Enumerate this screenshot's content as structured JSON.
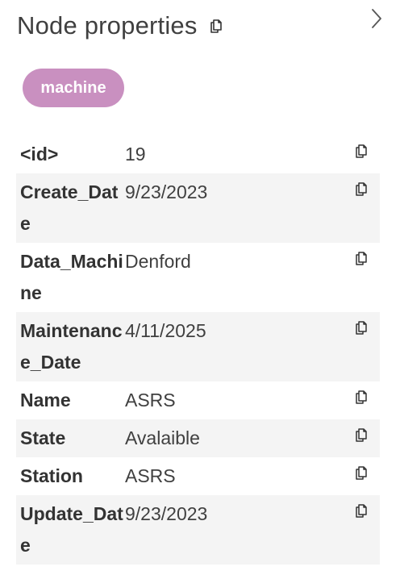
{
  "panel": {
    "title": "Node properties",
    "label_badge": "machine",
    "badge_color": "#c990c0",
    "icons": {
      "title_copy": "copy-icon",
      "collapse": "chevron-right-icon",
      "row_copy": "copy-icon"
    }
  },
  "properties": [
    {
      "key": "<id>",
      "value": "19"
    },
    {
      "key": "Create_Date",
      "value": "9/23/2023"
    },
    {
      "key": "Data_Machine",
      "value": "Denford"
    },
    {
      "key": "Maintenance_Date",
      "value": "4/11/2025"
    },
    {
      "key": "Name",
      "value": "ASRS"
    },
    {
      "key": "State",
      "value": "Avalaible"
    },
    {
      "key": "Station",
      "value": "ASRS"
    },
    {
      "key": "Update_Date",
      "value": "9/23/2023"
    }
  ]
}
